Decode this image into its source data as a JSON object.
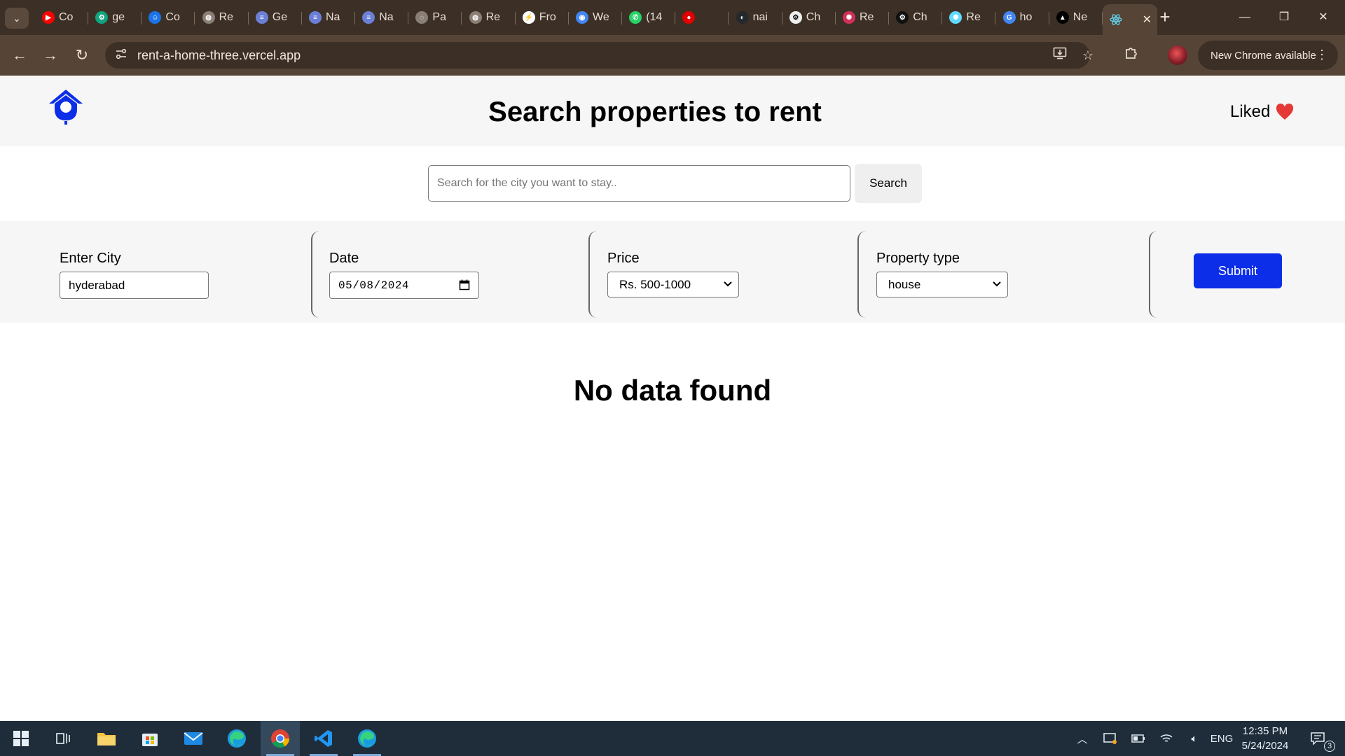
{
  "browser": {
    "tabs": [
      {
        "label": "Co",
        "icon": "youtube-icon",
        "color": "#ff0000"
      },
      {
        "label": "ge",
        "icon": "chatgpt-icon",
        "color": "#10a37f"
      },
      {
        "label": "Co",
        "icon": "contacts-icon",
        "color": "#1a73e8"
      },
      {
        "label": "Re",
        "icon": "globe-icon",
        "color": "#8a7f76"
      },
      {
        "label": "Ge",
        "icon": "gemini-icon",
        "color": "#6b7fd7"
      },
      {
        "label": "Na",
        "icon": "gemini-icon",
        "color": "#6b7fd7"
      },
      {
        "label": "Na",
        "icon": "gemini-icon",
        "color": "#6b7fd7"
      },
      {
        "label": "Pa",
        "icon": "loading-icon",
        "color": "#8a7f76"
      },
      {
        "label": "Re",
        "icon": "globe-icon",
        "color": "#8a7f76"
      },
      {
        "label": "Fro",
        "icon": "frontend-icon",
        "color": "#ffffff"
      },
      {
        "label": "We",
        "icon": "chrome-icon",
        "color": "#4285f4"
      },
      {
        "label": "(14",
        "icon": "whatsapp-icon",
        "color": "#25d366"
      },
      {
        "label": "",
        "icon": "record-icon",
        "color": "#e00000"
      },
      {
        "label": "nai",
        "icon": "github-icon",
        "color": "#24292e"
      },
      {
        "label": "Ch",
        "icon": "chatgpt-icon",
        "color": "#f0f0f0"
      },
      {
        "label": "Re",
        "icon": "react-icon",
        "color": "#d0305a"
      },
      {
        "label": "Ch",
        "icon": "chatgpt-icon",
        "color": "#111111"
      },
      {
        "label": "Re",
        "icon": "react-icon",
        "color": "#61dafb"
      },
      {
        "label": "ho",
        "icon": "google-icon",
        "color": "#4285f4"
      },
      {
        "label": "Ne",
        "icon": "vercel-icon",
        "color": "#000000"
      }
    ],
    "active_tab_icon": "react-icon",
    "url": "rent-a-home-three.vercel.app",
    "update_label": "New Chrome available"
  },
  "header": {
    "title": "Search properties to rent",
    "liked_label": "Liked",
    "brand_color": "#0c2ee8",
    "heart_color": "#e53935"
  },
  "search": {
    "placeholder": "Search for the city you want to stay..",
    "button_label": "Search"
  },
  "filters": {
    "city_label": "Enter City",
    "city_value": "hyderabad",
    "date_label": "Date",
    "date_value": "05/08/2024",
    "price_label": "Price",
    "price_value": "Rs. 500-1000",
    "type_label": "Property type",
    "type_value": "house",
    "submit_label": "Submit"
  },
  "results": {
    "empty_message": "No data found"
  },
  "taskbar": {
    "apps": [
      "windows-start-icon",
      "task-view-icon",
      "file-explorer-icon",
      "microsoft-store-icon",
      "mail-icon",
      "edge-icon",
      "chrome-icon",
      "vscode-icon",
      "edge-icon"
    ],
    "language": "ENG",
    "time": "12:35 PM",
    "date": "5/24/2024",
    "notifications": "3"
  }
}
